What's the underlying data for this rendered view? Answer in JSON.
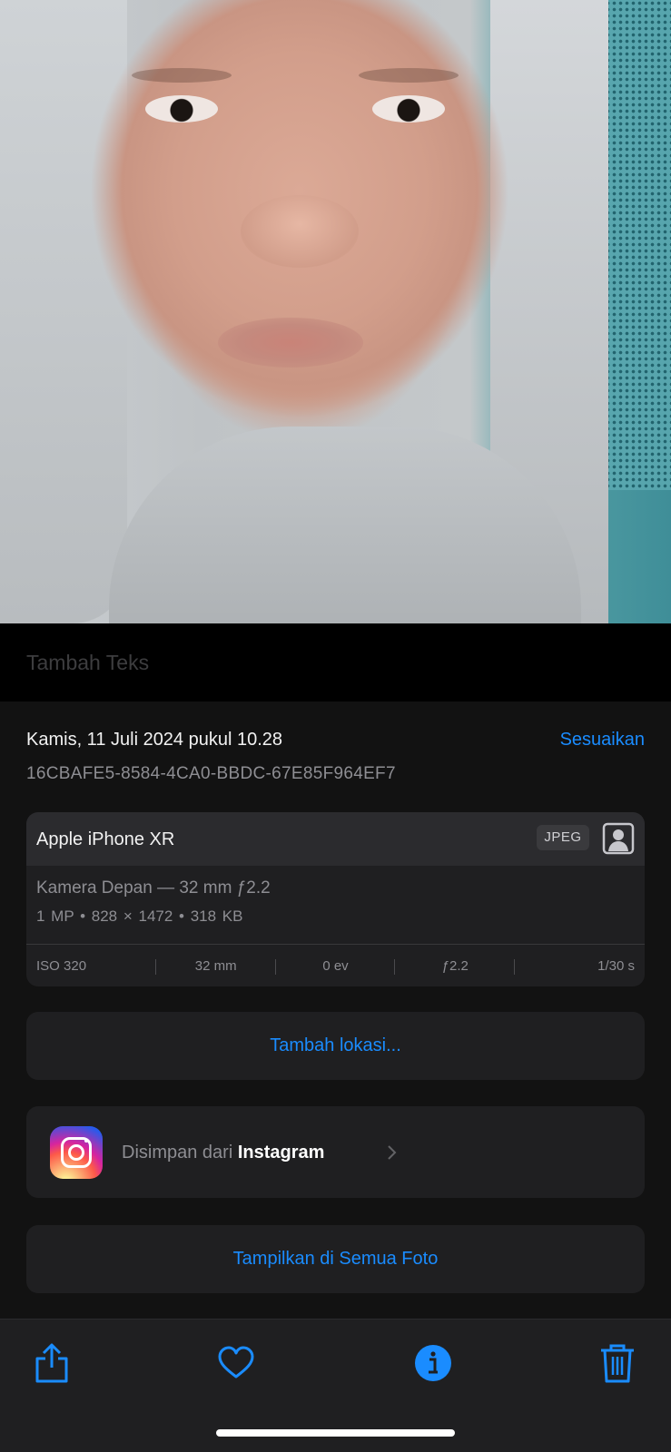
{
  "caption": {
    "placeholder": "Tambah Teks"
  },
  "info": {
    "date": "Kamis, 11 Juli 2024 pukul 10.28",
    "adjust_label": "Sesuaikan",
    "uuid": "16CBAFE5-8584-4CA0-BBDC-67E85F964EF7"
  },
  "camera": {
    "device": "Apple iPhone XR",
    "format": "JPEG",
    "lens": "Kamera Depan — 32 mm ƒ2.2",
    "specs": "1 MP  •  828 × 1472  •  318 KB",
    "exif": {
      "iso": "ISO 320",
      "focal": "32 mm",
      "ev": "0 ev",
      "aperture": "ƒ2.2",
      "shutter": "1/30 s"
    }
  },
  "location": {
    "label": "Tambah lokasi..."
  },
  "source": {
    "prefix": "Disimpan dari ",
    "app": "Instagram"
  },
  "show_all": {
    "label": "Tampilkan di Semua Foto"
  },
  "colors": {
    "accent": "#1a8cff",
    "panel": "#121212",
    "card": "#1f1f21"
  },
  "toolbar": {
    "icons": [
      "share-icon",
      "heart-icon",
      "info-icon",
      "trash-icon"
    ]
  }
}
